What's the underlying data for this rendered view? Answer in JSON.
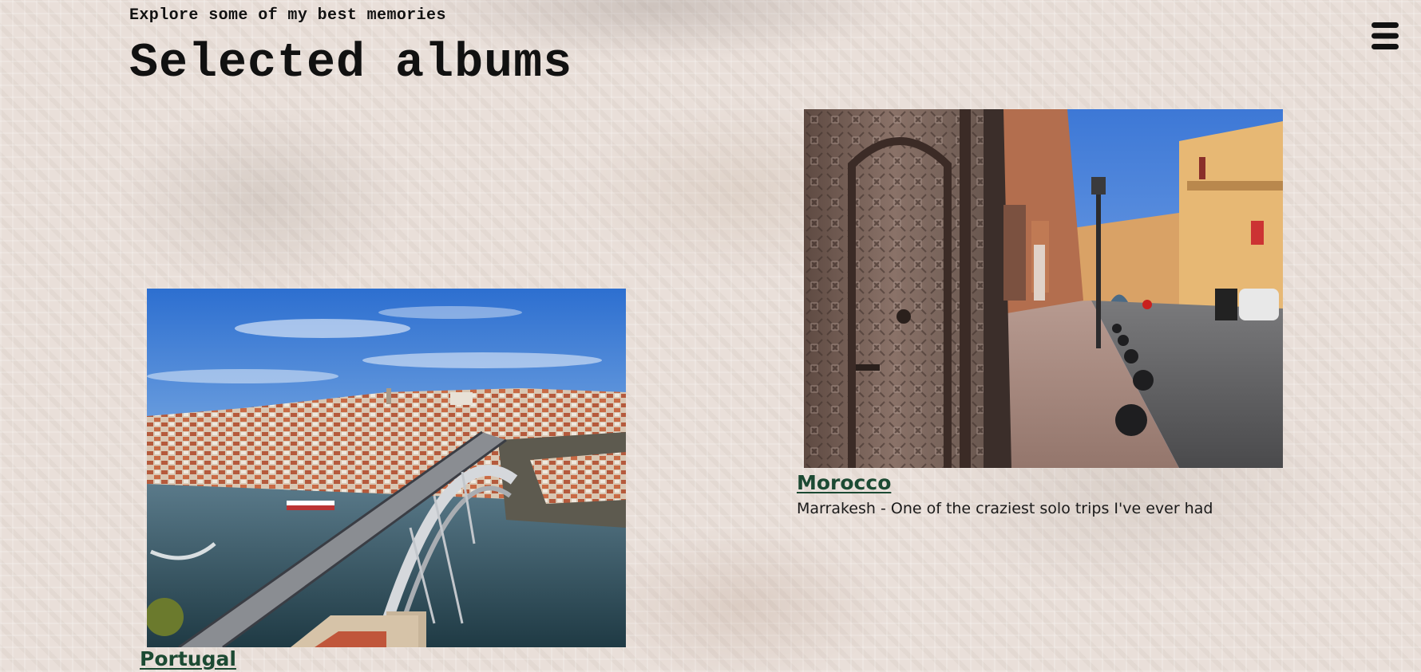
{
  "header": {
    "subtitle": "Explore some of my best memories",
    "title": "Selected albums"
  },
  "menu": {
    "icon": "hamburger-menu-icon"
  },
  "albums": [
    {
      "title": "Portugal",
      "description": "",
      "photo_subject": "porto-bridge-photo"
    },
    {
      "title": "Morocco",
      "description": "Marrakesh - One of the craziest solo trips I've ever had",
      "photo_subject": "marrakesh-street-photo"
    }
  ],
  "colors": {
    "link": "#1c4a33",
    "text": "#111111",
    "background": "#e9dfd9"
  }
}
